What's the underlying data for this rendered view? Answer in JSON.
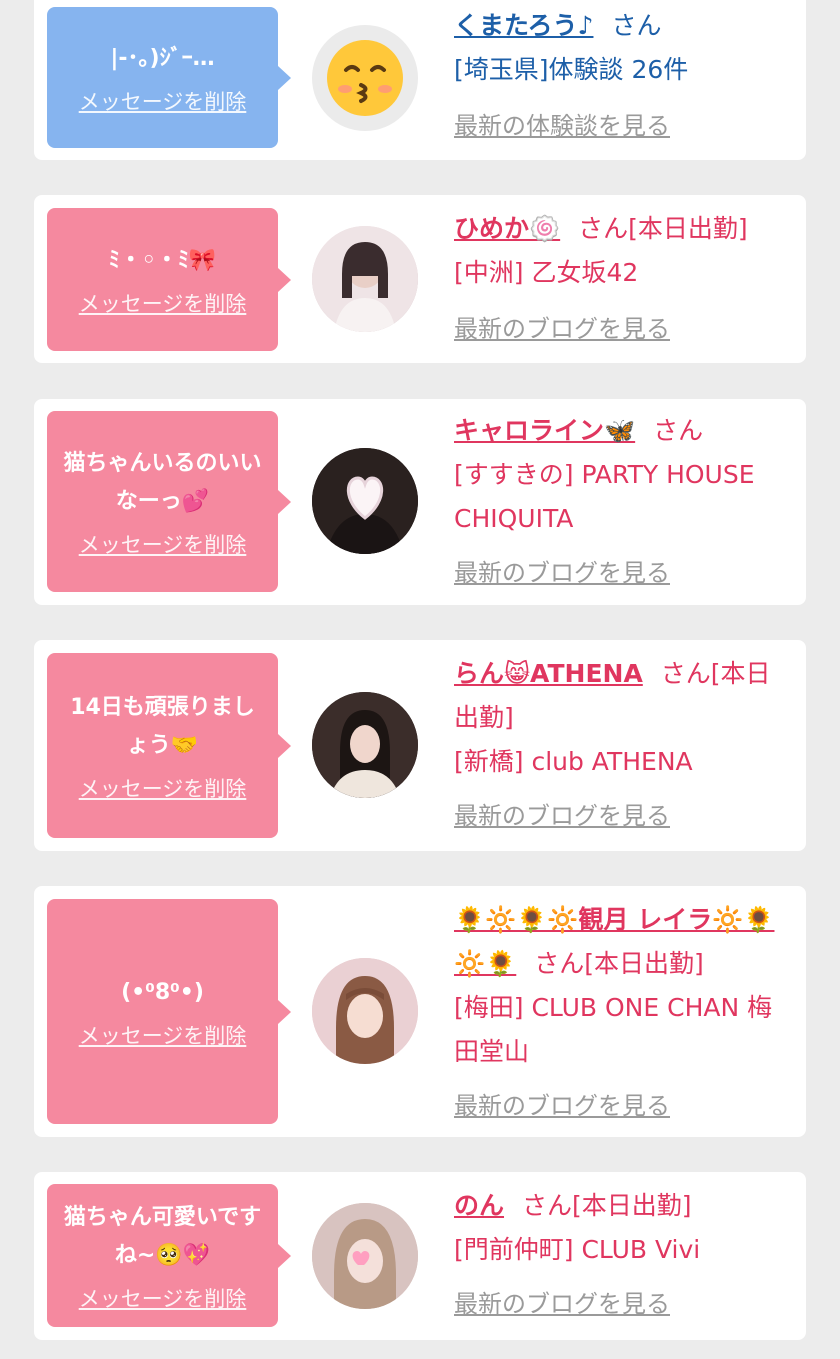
{
  "colors": {
    "blue_bubble": "#86b4ef",
    "pink_bubble": "#f5899f",
    "blue_text": "#1d5fa8",
    "pink_text": "#e0365f"
  },
  "items": [
    {
      "message": "|-･｡)ｼﾞｰ…",
      "delete_label": "メッセージを削除",
      "avatar_icon": "kissing-face-emoji",
      "name": "くまたろう♪",
      "san": "さん",
      "store": "[埼玉県]体験談 26件",
      "more": "最新の体験談を見る"
    },
    {
      "message": "ﾐ・◦・ﾐ🎀",
      "delete_label": "メッセージを削除",
      "avatar_icon": "photo-avatar",
      "name": "ひめか🍥",
      "san": "さん[本日出勤]",
      "store": "[中洲] 乙女坂42",
      "more": "最新のブログを見る"
    },
    {
      "message": "猫ちゃんいるのいいなーっ💕",
      "delete_label": "メッセージを削除",
      "avatar_icon": "photo-avatar",
      "name": "キャロライン🦋",
      "san": "さん",
      "store": "[すすきの] PARTY HOUSE CHIQUITA",
      "more": "最新のブログを見る"
    },
    {
      "message": "14日も頑張りましょう🤝",
      "delete_label": "メッセージを削除",
      "avatar_icon": "photo-avatar",
      "name": "らん😸ATHENA",
      "san": "さん[本日出勤]",
      "store": "[新橋] club ATHENA",
      "more": "最新のブログを見る"
    },
    {
      "message": "(•⁰8⁰•)",
      "delete_label": "メッセージを削除",
      "avatar_icon": "photo-avatar",
      "name": "🌻🔆🌻🔆観月 レイラ🔆🌻🔆🌻",
      "san": "さん[本日出勤]",
      "store": "[梅田] CLUB ONE CHAN 梅田堂山",
      "more": "最新のブログを見る"
    },
    {
      "message": "猫ちゃん可愛いですね~🥺💖",
      "delete_label": "メッセージを削除",
      "avatar_icon": "photo-avatar",
      "name": "のん",
      "san": "さん[本日出勤]",
      "store": "[門前仲町] CLUB Vivi",
      "more": "最新のブログを見る"
    }
  ]
}
